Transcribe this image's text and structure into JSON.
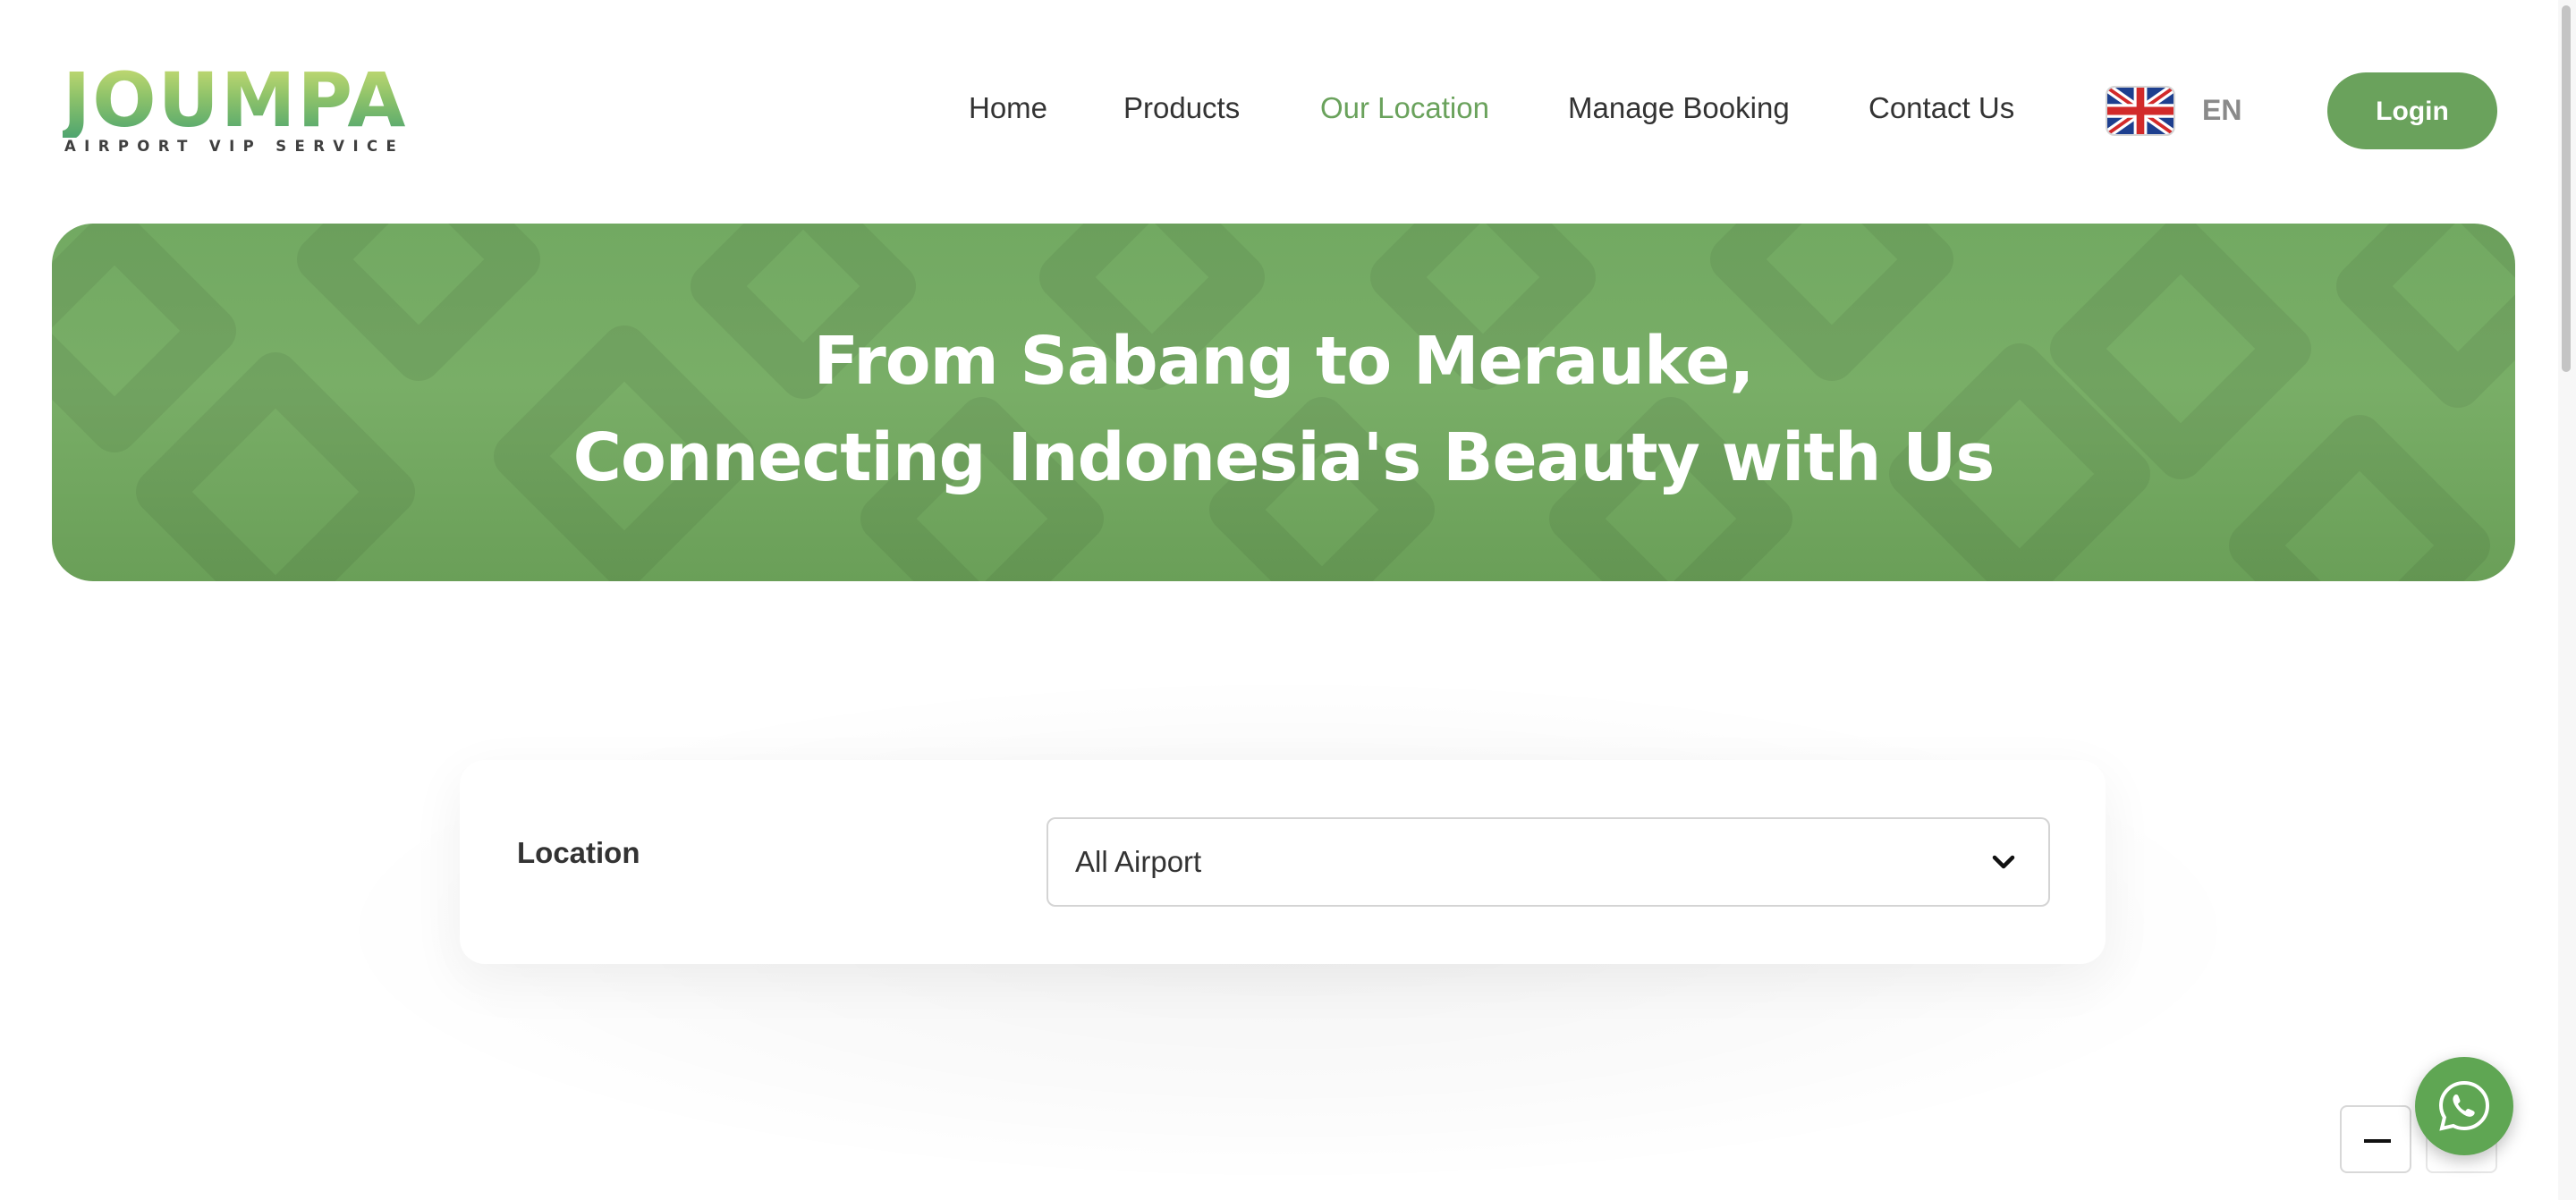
{
  "brand": {
    "logo_word": "JOUMPA",
    "tagline": "AIRPORT VIP SERVICE"
  },
  "nav": {
    "items": [
      {
        "label": "Home",
        "active": false
      },
      {
        "label": "Products",
        "active": false
      },
      {
        "label": "Our Location",
        "active": true
      },
      {
        "label": "Manage Booking",
        "active": false
      },
      {
        "label": "Contact Us",
        "active": false
      }
    ],
    "language": "EN",
    "language_flag": "uk-flag-icon",
    "login_label": "Login"
  },
  "hero": {
    "line1": "From Sabang to Merauke,",
    "line2": "Connecting Indonesia's Beauty with Us"
  },
  "filter": {
    "label": "Location",
    "selected": "All Airport"
  },
  "widgets": {
    "chat_icon": "whatsapp-icon",
    "minimize_icon": "minus-icon"
  },
  "colors": {
    "accent": "#6aa25c",
    "text": "#333333",
    "hero_bg": "#75ab64"
  }
}
